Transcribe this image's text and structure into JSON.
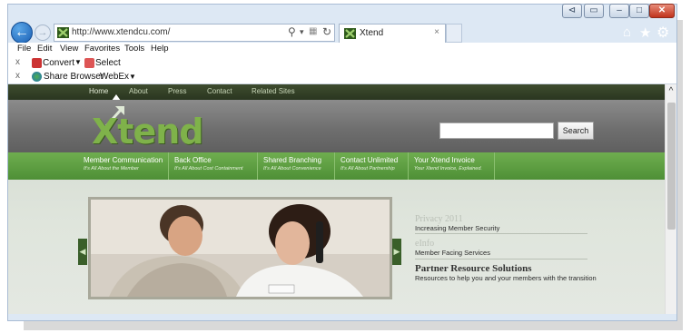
{
  "browser": {
    "url": "http://www.xtendcu.com/",
    "tab_title": "Xtend",
    "tab_close": "×",
    "back_glyph": "←",
    "forward_glyph": "→",
    "icons": [
      "back-icon",
      "forward-icon",
      "search-icon",
      "refresh-icon",
      "home-icon",
      "star-icon",
      "gear-icon"
    ],
    "caption": {
      "back": "⊲",
      "tab": "▭",
      "min": "–",
      "max": "□",
      "close": "✕"
    }
  },
  "menu": [
    "File",
    "Edit",
    "View",
    "Favorites",
    "Tools",
    "Help"
  ],
  "toolbar1": {
    "close": "x",
    "convert": "Convert",
    "select": "Select"
  },
  "toolbar2": {
    "close": "x",
    "share": "Share Browser",
    "webex": "WebEx"
  },
  "site": {
    "nav": [
      "Home",
      "About",
      "Press",
      "Contact",
      "Related Sites"
    ],
    "logo_text": "Xtend",
    "search_button": "Search",
    "categories": [
      {
        "title": "Member Communication",
        "subtitle": "It's All About the Member"
      },
      {
        "title": "Back Office",
        "subtitle": "It's All About Cost Containment"
      },
      {
        "title": "Shared Branching",
        "subtitle": "It's All About Convenience"
      },
      {
        "title": "Contact Unlimited",
        "subtitle": "It's All About Partnership"
      },
      {
        "title": "Your Xtend Invoice",
        "subtitle": "Your Xtend Invoice, Explained."
      }
    ],
    "slider": {
      "prev": "◀",
      "next": "▶"
    },
    "news": [
      {
        "title": "Privacy 2011",
        "subtitle": "Increasing Member Security"
      },
      {
        "title": "eInfo",
        "subtitle": "Member Facing Services"
      },
      {
        "title": "Partner Resource Solutions",
        "subtitle": "Resources to help you and your members with the transition"
      }
    ]
  },
  "colors": {
    "accent_green": "#5d9e40",
    "dark_nav": "#2f3b24",
    "ie_blue": "#1a5fb4"
  }
}
